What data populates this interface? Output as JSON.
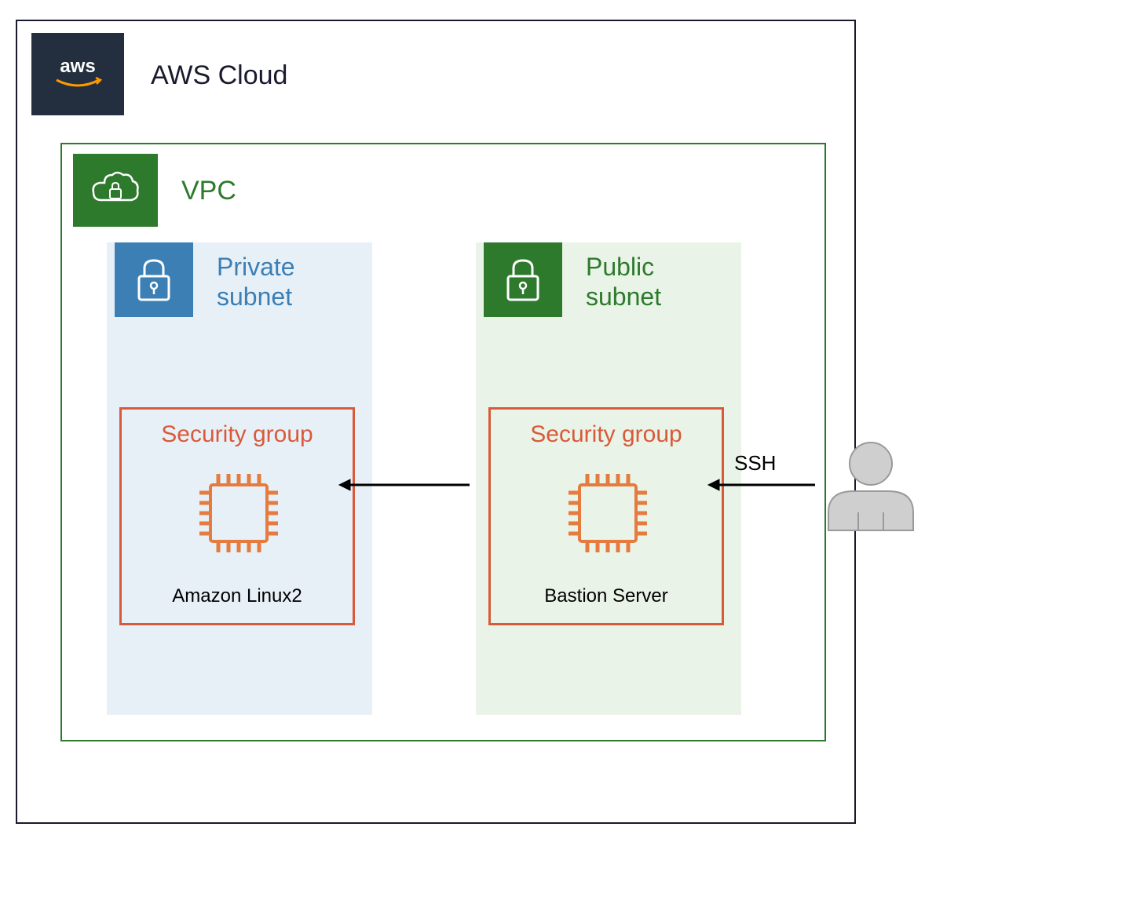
{
  "aws_cloud": {
    "label": "AWS Cloud",
    "logo_text": "aws"
  },
  "vpc": {
    "label": "VPC"
  },
  "private_subnet": {
    "label": "Private\nsubnet",
    "security_group_label": "Security group",
    "instance_label": "Amazon Linux2"
  },
  "public_subnet": {
    "label": "Public\nsubnet",
    "security_group_label": "Security group",
    "instance_label": "Bastion Server"
  },
  "connection": {
    "label": "SSH"
  },
  "colors": {
    "aws_navy": "#232f3e",
    "vpc_green": "#2d7a2d",
    "private_blue": "#3b7fb5",
    "public_green": "#2d7a2d",
    "security_red": "#d85a3a",
    "ec2_orange": "#e57b3e"
  }
}
